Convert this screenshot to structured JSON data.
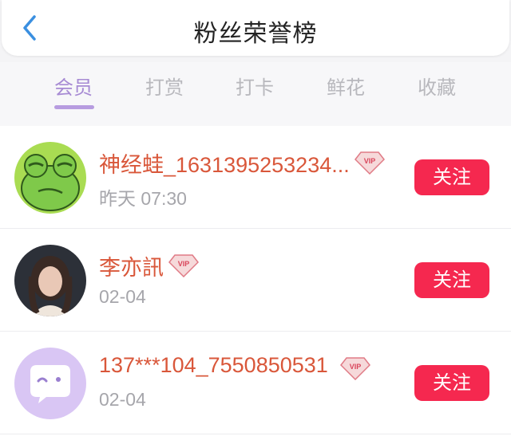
{
  "header": {
    "title": "粉丝荣誉榜",
    "back_icon": "chevron-left-icon"
  },
  "tabs": [
    {
      "label": "会员",
      "active": true
    },
    {
      "label": "打赏",
      "active": false
    },
    {
      "label": "打卡",
      "active": false
    },
    {
      "label": "鲜花",
      "active": false
    },
    {
      "label": "收藏",
      "active": false
    }
  ],
  "colors": {
    "accent_tab": "#a78bd4",
    "name": "#d9573a",
    "follow_button": "#f5284f"
  },
  "members": [
    {
      "name": "神经蛙_1631395253234...",
      "badge": "VIP",
      "time": "昨天 07:30",
      "follow_label": "关注",
      "avatar": "frog-avatar"
    },
    {
      "name": "李亦訊",
      "badge": "VIP",
      "time": "02-04",
      "follow_label": "关注",
      "avatar": "photo-avatar"
    },
    {
      "name": "137***104_7550850531",
      "badge": "VIP",
      "time": "02-04",
      "follow_label": "关注",
      "avatar": "chat-bubble-avatar"
    }
  ]
}
